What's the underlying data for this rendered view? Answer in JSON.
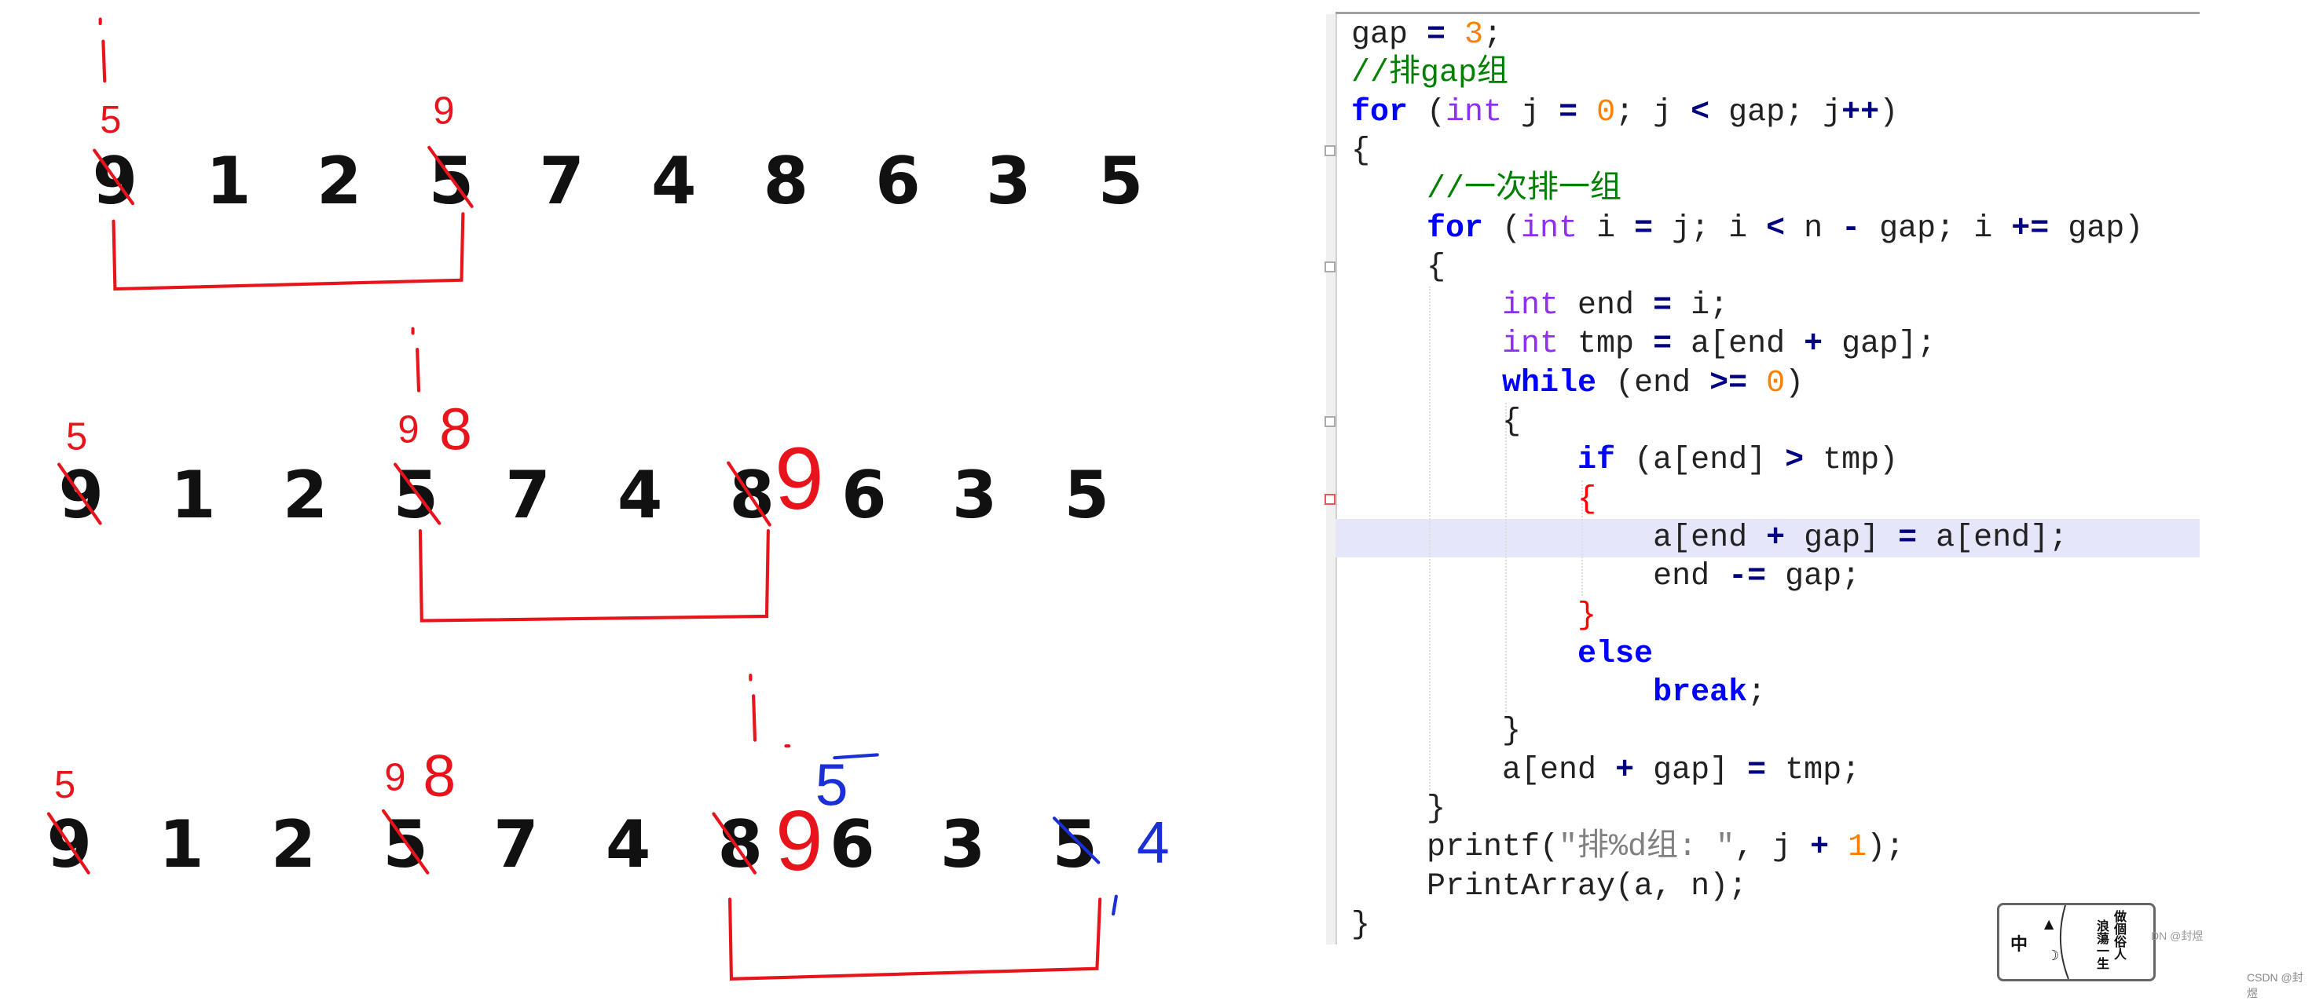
{
  "rows": [
    {
      "digits": [
        "9",
        "1",
        "2",
        "5",
        "7",
        "4",
        "8",
        "6",
        "3",
        "5"
      ],
      "notes": [
        "5",
        "9"
      ]
    },
    {
      "digits": [
        "9",
        "1",
        "2",
        "5",
        "7",
        "4",
        "8",
        "6",
        "3",
        "5"
      ],
      "notes": [
        "5",
        "9",
        "8",
        "9"
      ]
    },
    {
      "digits": [
        "9",
        "1",
        "2",
        "5",
        "7",
        "4",
        "8",
        "6",
        "3",
        "5"
      ],
      "notes": [
        "5",
        "9",
        "8",
        "9",
        "5",
        "4"
      ]
    }
  ],
  "colors": {
    "annotation_red": "#e8141c",
    "annotation_blue": "#1a2fd6",
    "keyword": "#0000ff",
    "type": "#8f2ff0",
    "number": "#ff8000",
    "comment": "#008000"
  },
  "code": [
    [
      [
        "gap ",
        "id"
      ],
      [
        "=",
        "op"
      ],
      [
        " ",
        "id"
      ],
      [
        "3",
        "num"
      ],
      [
        ";",
        "id"
      ]
    ],
    [
      [
        "//排gap组",
        "cm"
      ]
    ],
    [
      [
        "for",
        "kw"
      ],
      [
        " (",
        "id"
      ],
      [
        "int",
        "type"
      ],
      [
        " j ",
        "id"
      ],
      [
        "=",
        "op"
      ],
      [
        " ",
        "id"
      ],
      [
        "0",
        "num"
      ],
      [
        "; j ",
        "id"
      ],
      [
        "<",
        "op"
      ],
      [
        " gap; j",
        "id"
      ],
      [
        "++",
        "op"
      ],
      [
        ")",
        "id"
      ]
    ],
    [
      [
        "{",
        "id"
      ]
    ],
    [
      [
        "    ",
        "id"
      ],
      [
        "//一次排一组",
        "cm"
      ]
    ],
    [
      [
        "    ",
        "id"
      ],
      [
        "for",
        "kw"
      ],
      [
        " (",
        "id"
      ],
      [
        "int",
        "type"
      ],
      [
        " i ",
        "id"
      ],
      [
        "=",
        "op"
      ],
      [
        " j; i ",
        "id"
      ],
      [
        "<",
        "op"
      ],
      [
        " n ",
        "id"
      ],
      [
        "-",
        "op"
      ],
      [
        " gap; i ",
        "id"
      ],
      [
        "+=",
        "op"
      ],
      [
        " gap)",
        "id"
      ]
    ],
    [
      [
        "    {",
        "id"
      ]
    ],
    [
      [
        "        ",
        "id"
      ],
      [
        "int",
        "type"
      ],
      [
        " end ",
        "id"
      ],
      [
        "=",
        "op"
      ],
      [
        " i;",
        "id"
      ]
    ],
    [
      [
        "        ",
        "id"
      ],
      [
        "int",
        "type"
      ],
      [
        " tmp ",
        "id"
      ],
      [
        "=",
        "op"
      ],
      [
        " a[end ",
        "id"
      ],
      [
        "+",
        "op"
      ],
      [
        " gap];",
        "id"
      ]
    ],
    [
      [
        "        ",
        "id"
      ],
      [
        "while",
        "kw"
      ],
      [
        " (end ",
        "id"
      ],
      [
        ">=",
        "op"
      ],
      [
        " ",
        "id"
      ],
      [
        "0",
        "num"
      ],
      [
        ")",
        "id"
      ]
    ],
    [
      [
        "        {",
        "id"
      ]
    ],
    [
      [
        "            ",
        "id"
      ],
      [
        "if",
        "kw"
      ],
      [
        " (a[end] ",
        "id"
      ],
      [
        ">",
        "op"
      ],
      [
        " tmp)",
        "id"
      ]
    ],
    [
      [
        "            ",
        "id"
      ],
      [
        "{",
        "brace-red"
      ]
    ],
    [
      [
        "                a[end ",
        "id"
      ],
      [
        "+",
        "op"
      ],
      [
        " gap] ",
        "id"
      ],
      [
        "=",
        "op"
      ],
      [
        " a[end];",
        "id"
      ]
    ],
    [
      [
        "                end ",
        "id"
      ],
      [
        "-=",
        "op"
      ],
      [
        " gap;",
        "id"
      ]
    ],
    [
      [
        "            ",
        "id"
      ],
      [
        "}",
        "brace-red"
      ]
    ],
    [
      [
        "            ",
        "id"
      ],
      [
        "else",
        "kw"
      ]
    ],
    [
      [
        "                ",
        "id"
      ],
      [
        "break",
        "kw"
      ],
      [
        ";",
        "id"
      ]
    ],
    [
      [
        "        }",
        "id"
      ]
    ],
    [
      [
        "        a[end ",
        "id"
      ],
      [
        "+",
        "op"
      ],
      [
        " gap] ",
        "id"
      ],
      [
        "=",
        "op"
      ],
      [
        " tmp;",
        "id"
      ]
    ],
    [
      [
        "    }",
        "id"
      ]
    ],
    [
      [
        "    printf(",
        "id"
      ],
      [
        "\"排%d组: \"",
        "str"
      ],
      [
        ", j ",
        "id"
      ],
      [
        "+",
        "op"
      ],
      [
        " ",
        "id"
      ],
      [
        "1",
        "num"
      ],
      [
        ");",
        "id"
      ]
    ],
    [
      [
        "    PrintArray(a, n);",
        "id"
      ]
    ],
    [
      [
        "}",
        "id"
      ]
    ]
  ],
  "highlight_line": 13,
  "stamp": {
    "left": "中",
    "right_col1": "做個俗人",
    "right_col2": "浪蕩一生"
  },
  "watermark": "CSDN @封煜",
  "watermark_partial": "DN @封煜"
}
